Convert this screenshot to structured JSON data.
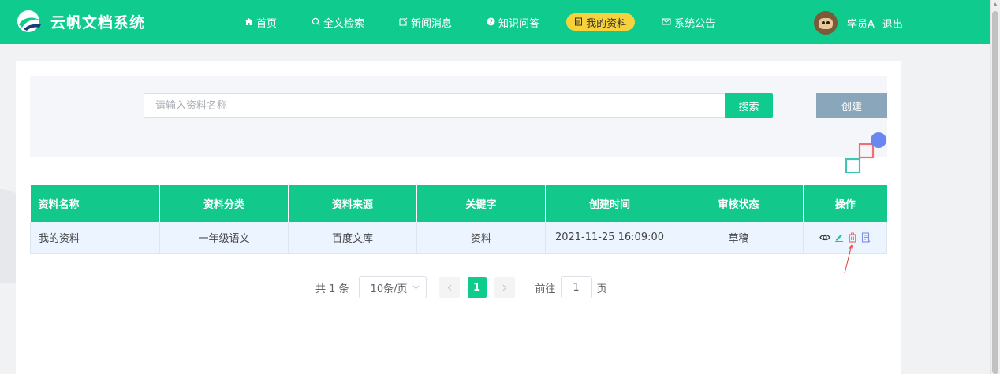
{
  "app": {
    "title": "云帆文档系统"
  },
  "nav": {
    "items": [
      {
        "label": "首页",
        "icon": "home-icon"
      },
      {
        "label": "全文检索",
        "icon": "search-icon"
      },
      {
        "label": "新闻消息",
        "icon": "news-icon"
      },
      {
        "label": "知识问答",
        "icon": "question-icon"
      },
      {
        "label": "我的资料",
        "icon": "document-icon",
        "active": true
      },
      {
        "label": "系统公告",
        "icon": "mail-icon"
      }
    ],
    "active_color": "#f7d23a"
  },
  "user": {
    "name": "学员A",
    "logout_label": "退出"
  },
  "search": {
    "placeholder": "请输入资料名称",
    "value": "",
    "button_label": "搜索",
    "create_label": "创建"
  },
  "table": {
    "columns": [
      "资料名称",
      "资料分类",
      "资料来源",
      "关键字",
      "创建时间",
      "审核状态",
      "操作"
    ],
    "rows": [
      {
        "name": "我的资料",
        "category": "一年级语文",
        "source": "百度文库",
        "keyword": "资料",
        "created": "2021-11-25 16:09:00",
        "status": "草稿",
        "actions": [
          "view-icon",
          "edit-icon",
          "delete-icon",
          "detail-icon"
        ]
      }
    ]
  },
  "pagination": {
    "total_label": "共 1 条",
    "page_size": "10条/页",
    "current_page": "1",
    "goto_label": "前往",
    "goto_value": "1",
    "page_suffix": "页"
  },
  "colors": {
    "primary": "#0fcc8e",
    "create_button": "#8aa6bb",
    "delete": "#f56c6c",
    "edit": "#13c98b"
  }
}
